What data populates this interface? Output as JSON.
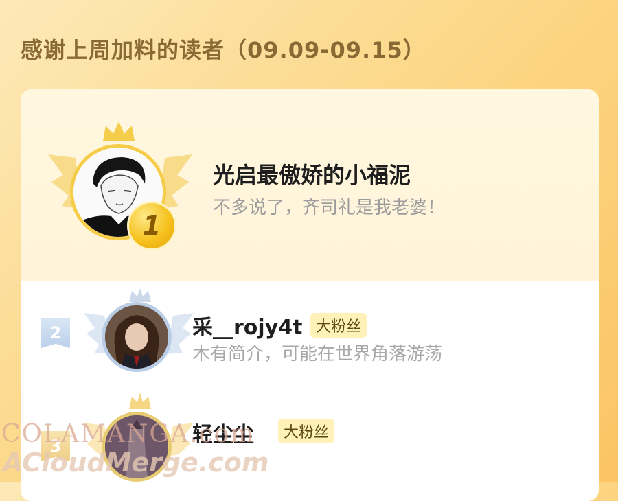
{
  "header": {
    "title": "感谢上周加料的读者（09.09-09.15）"
  },
  "top_reader": {
    "rank": "1",
    "name": "光启最傲娇的小福泥",
    "bio": "不多说了，齐司礼是我老婆！"
  },
  "readers": [
    {
      "rank": "2",
      "name": "采__rojy4t",
      "badge": "大粉丝",
      "bio": "木有简介，可能在世界角落游荡"
    },
    {
      "rank": "3",
      "name": "轻尘尘",
      "badge": "大粉丝",
      "bio": ""
    }
  ],
  "watermark": {
    "line1": "COLAMANGA.com",
    "line2": "ACloudMerge.com"
  },
  "colors": {
    "gold": "#f6c21e",
    "silver": "#bcd0ea",
    "background": "#fcd889"
  }
}
